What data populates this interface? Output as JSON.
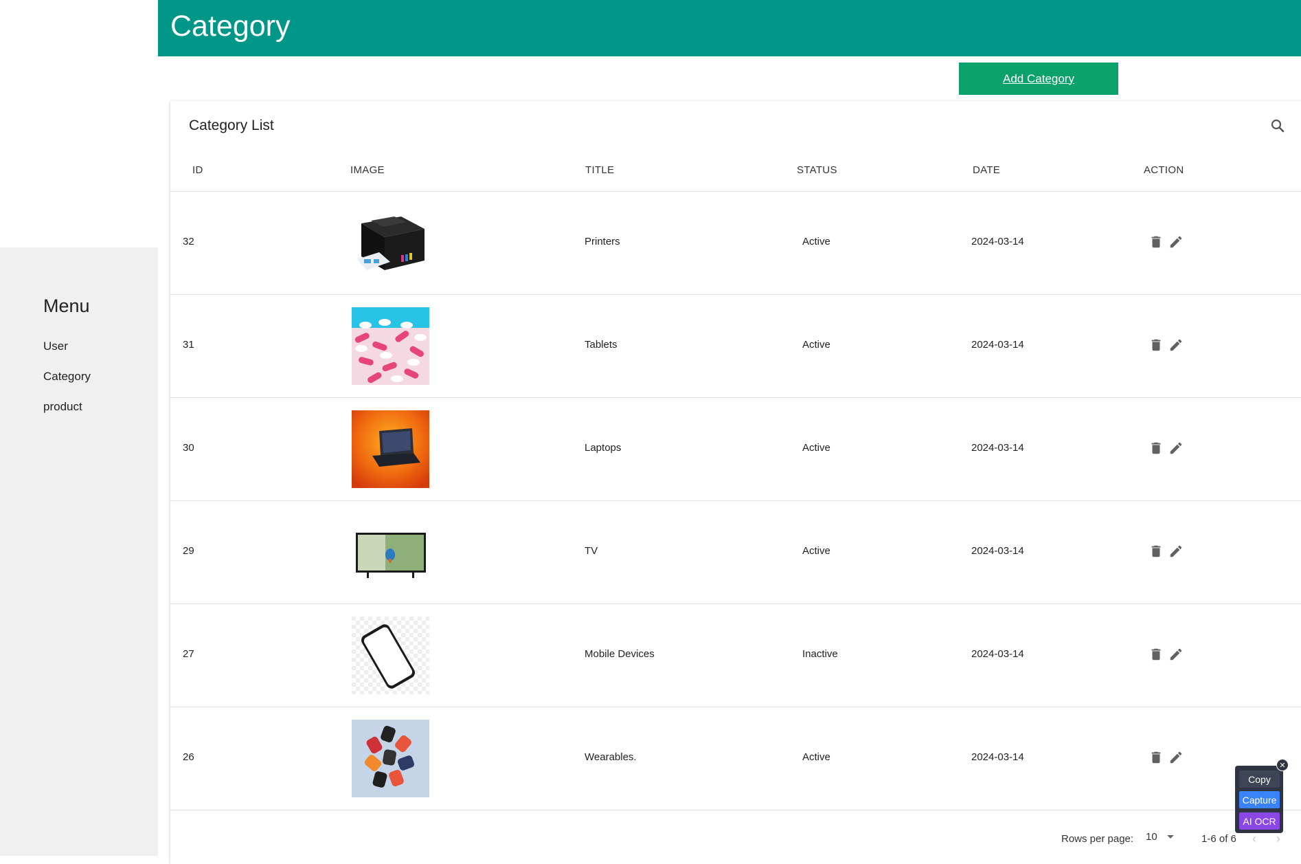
{
  "header": {
    "title": "Category"
  },
  "actions": {
    "add_label": "Add Category"
  },
  "sidebar": {
    "title": "Menu",
    "items": [
      {
        "label": "User"
      },
      {
        "label": "Category"
      },
      {
        "label": "product"
      }
    ]
  },
  "table": {
    "title": "Category List",
    "columns": [
      "ID",
      "IMAGE",
      "TITLE",
      "STATUS",
      "DATE",
      "ACTION"
    ],
    "rows": [
      {
        "id": "32",
        "title": "Printers",
        "status": "Active",
        "date": "2024-03-14",
        "image": "printer"
      },
      {
        "id": "31",
        "title": "Tablets",
        "status": "Active",
        "date": "2024-03-14",
        "image": "pills"
      },
      {
        "id": "30",
        "title": "Laptops",
        "status": "Active",
        "date": "2024-03-14",
        "image": "laptop"
      },
      {
        "id": "29",
        "title": "TV",
        "status": "Active",
        "date": "2024-03-14",
        "image": "tv"
      },
      {
        "id": "27",
        "title": "Mobile Devices",
        "status": "Inactive",
        "date": "2024-03-14",
        "image": "phone"
      },
      {
        "id": "26",
        "title": "Wearables.",
        "status": "Active",
        "date": "2024-03-14",
        "image": "watches"
      }
    ]
  },
  "pagination": {
    "rows_per_page_label": "Rows per page:",
    "rows_per_page": "10",
    "range": "1-6 of 6"
  },
  "widget": {
    "copy": "Copy",
    "capture": "Capture",
    "ocr": "AI OCR"
  },
  "colors": {
    "header": "#009688",
    "add_button": "#0aa26a",
    "sidebar": "#f0f0f0"
  }
}
